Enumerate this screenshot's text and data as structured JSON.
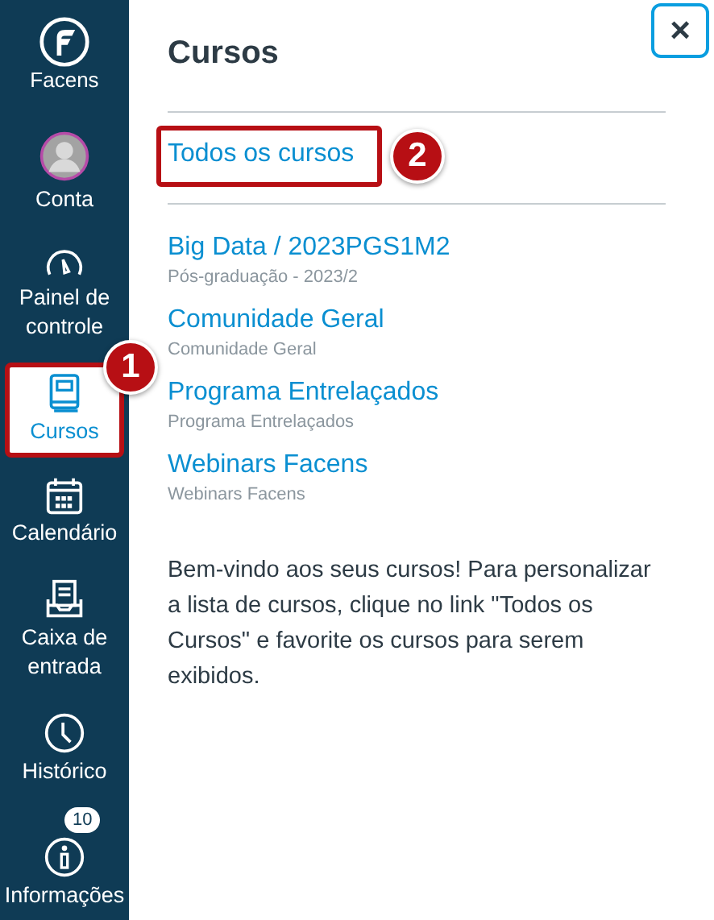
{
  "sidebar": {
    "logo": "Facens",
    "items": [
      {
        "kind": "avatar",
        "label": "Conta",
        "selected": false
      },
      {
        "kind": "dashboard",
        "label": "Painel de controle",
        "selected": false
      },
      {
        "kind": "courses",
        "label": "Cursos",
        "selected": true,
        "step": "1"
      },
      {
        "kind": "calendar",
        "label": "Calendário",
        "selected": false
      },
      {
        "kind": "inbox",
        "label": "Caixa de entrada",
        "selected": false
      },
      {
        "kind": "history",
        "label": "Histórico",
        "selected": false
      },
      {
        "kind": "info",
        "label": "Informações",
        "selected": false,
        "badge": "10"
      }
    ]
  },
  "tray": {
    "title": "Cursos",
    "close": "×",
    "all_courses": {
      "label": "Todos os cursos",
      "step": "2"
    },
    "courses": [
      {
        "name": "Big Data / 2023PGS1M2",
        "term": "Pós-graduação - 2023/2"
      },
      {
        "name": "Comunidade Geral",
        "term": "Comunidade Geral"
      },
      {
        "name": "Programa Entrelaçados",
        "term": "Programa Entrelaçados"
      },
      {
        "name": "Webinars Facens",
        "term": "Webinars Facens"
      }
    ],
    "welcome": "Bem-vindo aos seus cursos! Para personalizar a lista de cursos, clique no link \"Todos os Cursos\" e favorite os cursos para serem exibidos."
  }
}
